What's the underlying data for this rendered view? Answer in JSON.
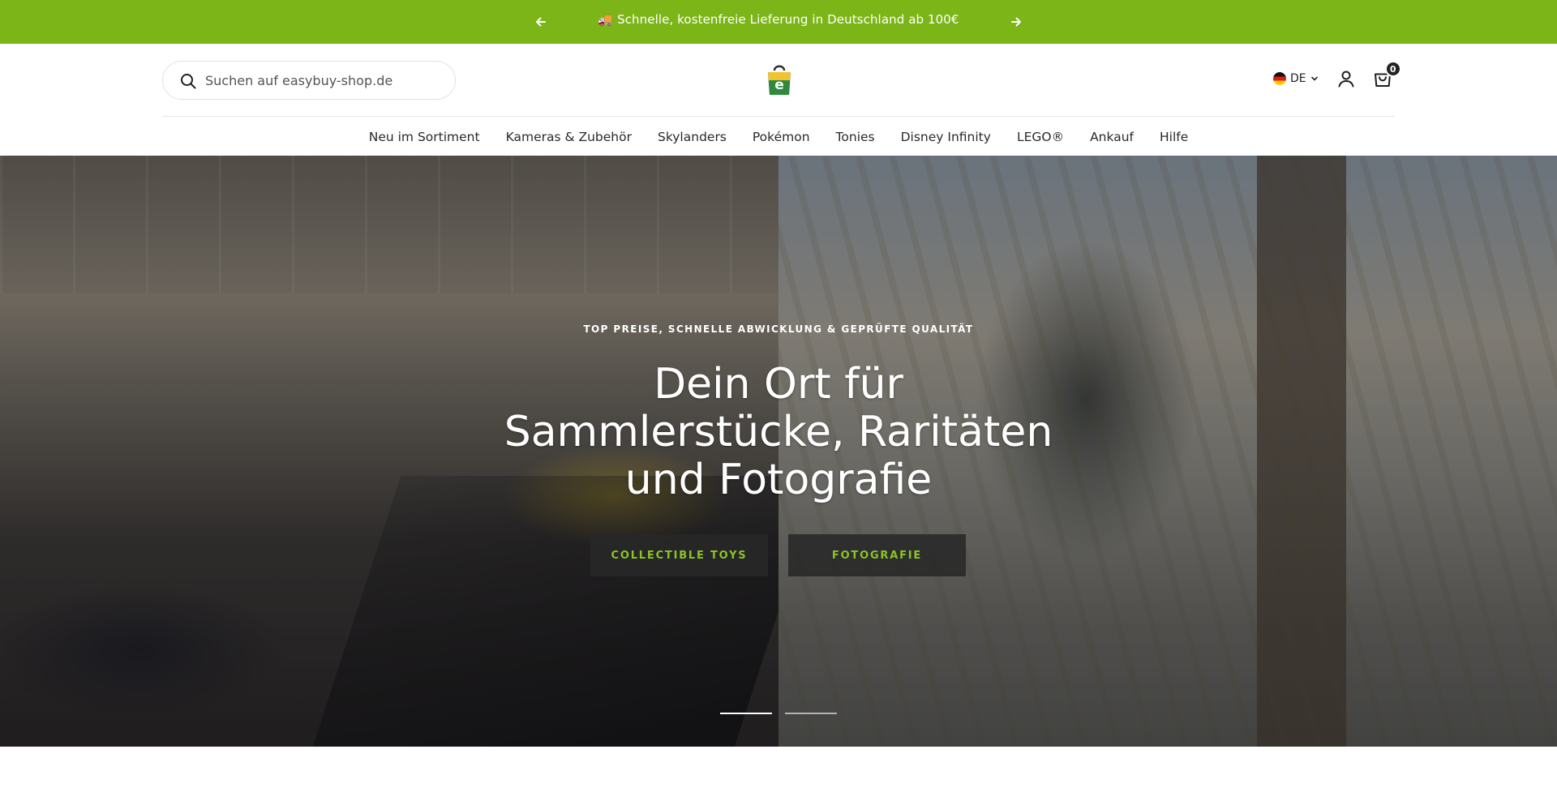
{
  "announcement": {
    "text": "🚚 Schnelle, kostenfreie Lieferung in Deutschland ab 100€",
    "prev_icon": "arrow-left-icon",
    "next_icon": "arrow-right-icon"
  },
  "header": {
    "search_placeholder": "Suchen auf easybuy-shop.de",
    "logo_letter": "e",
    "language": "DE",
    "cart_count": "0"
  },
  "nav": {
    "items": [
      "Neu im Sortiment",
      "Kameras & Zubehör",
      "Skylanders",
      "Pokémon",
      "Tonies",
      "Disney Infinity",
      "LEGO®",
      "Ankauf",
      "Hilfe"
    ]
  },
  "hero": {
    "subtitle": "TOP PREISE, SCHNELLE ABWICKLUNG & GEPRÜFTE QUALITÄT",
    "title_line1": "Dein Ort für",
    "title_line2": "Sammlerstücke, Raritäten",
    "title_line3": "und Fotografie",
    "button_toys": "COLLECTIBLE TOYS",
    "button_foto": "FOTOGRAFIE"
  },
  "colors": {
    "brand_green": "#7cb518",
    "button_text": "#8bc424",
    "button_bg": "#282828"
  }
}
